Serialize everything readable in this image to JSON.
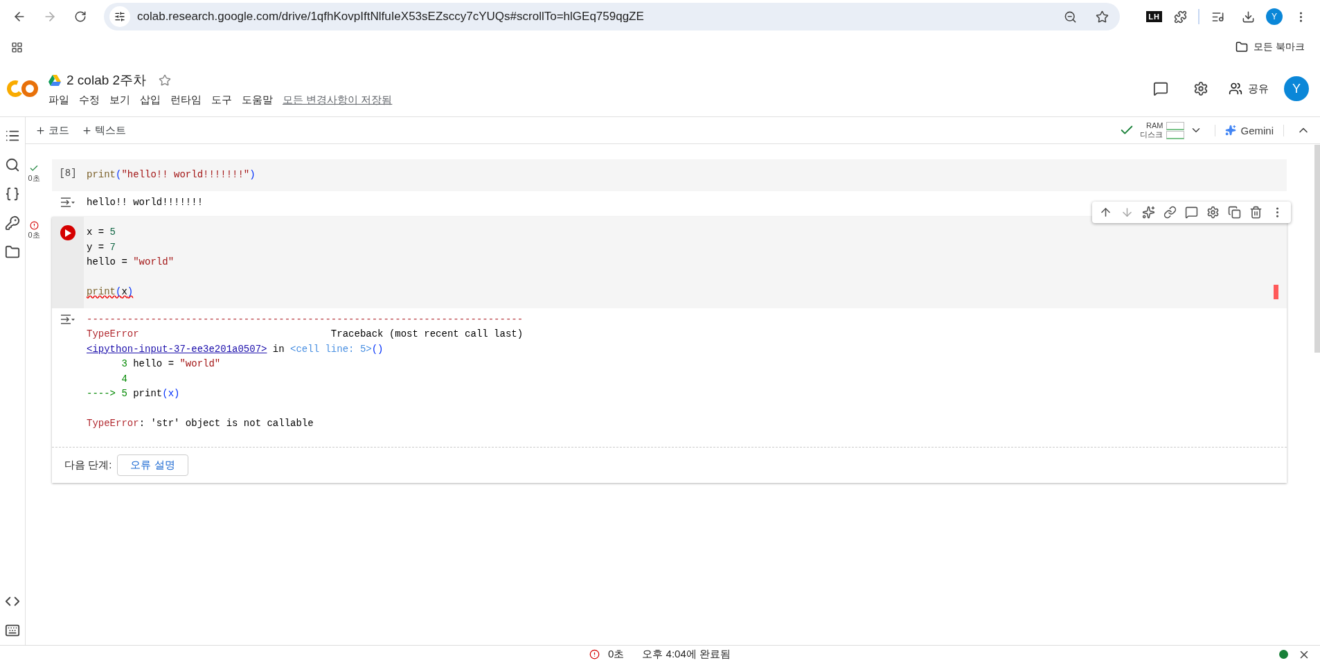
{
  "browser": {
    "url": "colab.research.google.com/drive/1qfhKovpIftNlfuIeX53sEZsccy7cYUQs#scrollTo=hlGEq759qgZE",
    "extension_badge": "LH",
    "profile_initial": "Y",
    "bookmarks_label": "모든 북마크"
  },
  "notebook": {
    "title": "2 colab 2주차",
    "starred": false,
    "menu": [
      "파일",
      "수정",
      "보기",
      "삽입",
      "런타임",
      "도구",
      "도움말"
    ],
    "save_status": "모든 변경사항이 저장됨",
    "share_label": "공유",
    "avatar_initial": "Y"
  },
  "toolbar": {
    "add_buttons": [
      "코드",
      "텍스트"
    ],
    "runtime": {
      "connected": true,
      "ram_label": "RAM",
      "disk_label": "디스크"
    },
    "gemini_label": "Gemini"
  },
  "cells": [
    {
      "error": false,
      "time": "0초",
      "exec_count": "[8]",
      "focused": false,
      "lines": [
        {
          "kind": "code",
          "tokens": [
            {
              "kind": "func",
              "text": "print"
            },
            {
              "kind": "paren",
              "text": "("
            },
            {
              "kind": "string",
              "text": "\"hello!! world!!!!!!!\""
            },
            {
              "kind": "paren",
              "text": ")"
            }
          ]
        }
      ],
      "output": {
        "kind": "stream",
        "lines": [
          {
            "kind": "code",
            "tokens": [
              {
                "kind": "plain",
                "text": "hello!! world!!!!!!!"
              }
            ]
          }
        ]
      }
    },
    {
      "error": true,
      "time": "0초",
      "focused": true,
      "lines": [
        {
          "kind": "code",
          "tokens": [
            {
              "kind": "plain",
              "text": "x = "
            },
            {
              "kind": "number",
              "text": "5"
            }
          ]
        },
        {
          "kind": "code",
          "tokens": [
            {
              "kind": "plain",
              "text": "y = "
            },
            {
              "kind": "number",
              "text": "7"
            }
          ]
        },
        {
          "kind": "code",
          "tokens": [
            {
              "kind": "plain",
              "text": "hello = "
            },
            {
              "kind": "string",
              "text": "\"world\""
            }
          ]
        },
        {
          "kind": "blank"
        },
        {
          "kind": "code",
          "tokens": [
            {
              "kind": "func",
              "text": "print",
              "lint": true
            },
            {
              "kind": "paren",
              "text": "(",
              "lint": true
            },
            {
              "kind": "plain",
              "text": "x",
              "lint": true
            },
            {
              "kind": "paren",
              "text": ")",
              "lint": true
            }
          ]
        }
      ],
      "output": {
        "kind": "error",
        "lines": [
          {
            "kind": "code",
            "tokens": [
              {
                "kind": "error",
                "text": "---------------------------------------------------------------------------"
              }
            ]
          },
          {
            "kind": "code",
            "tokens": [
              {
                "kind": "error",
                "text": "TypeError"
              },
              {
                "kind": "plain",
                "text": "                                 Traceback (most recent call last)"
              }
            ]
          },
          {
            "kind": "code",
            "tokens": [
              {
                "kind": "link",
                "text": "<ipython-input-37-ee3e201a0507>"
              },
              {
                "kind": "plain",
                "text": " in "
              },
              {
                "kind": "ref",
                "text": "<cell line: 5>"
              },
              {
                "kind": "paren",
                "text": "()"
              }
            ]
          },
          {
            "kind": "code",
            "tokens": [
              {
                "kind": "green",
                "text": "      3 "
              },
              {
                "kind": "plain",
                "text": "hello = "
              },
              {
                "kind": "string",
                "text": "\"world\""
              }
            ]
          },
          {
            "kind": "code",
            "tokens": [
              {
                "kind": "green",
                "text": "      4"
              }
            ]
          },
          {
            "kind": "code",
            "tokens": [
              {
                "kind": "green",
                "text": "----> 5 "
              },
              {
                "kind": "plain",
                "text": "print"
              },
              {
                "kind": "paren",
                "text": "(x)"
              }
            ]
          },
          {
            "kind": "blank"
          },
          {
            "kind": "code",
            "tokens": [
              {
                "kind": "error",
                "text": "TypeError"
              },
              {
                "kind": "plain",
                "text": ": 'str' object is not callable"
              }
            ]
          }
        ],
        "next_steps": {
          "label": "다음 단계:",
          "button": "오류 설명"
        }
      }
    }
  ],
  "status_bar": {
    "error": true,
    "time": "0초",
    "message": "오후 4:04에 완료됨",
    "connected": true
  }
}
